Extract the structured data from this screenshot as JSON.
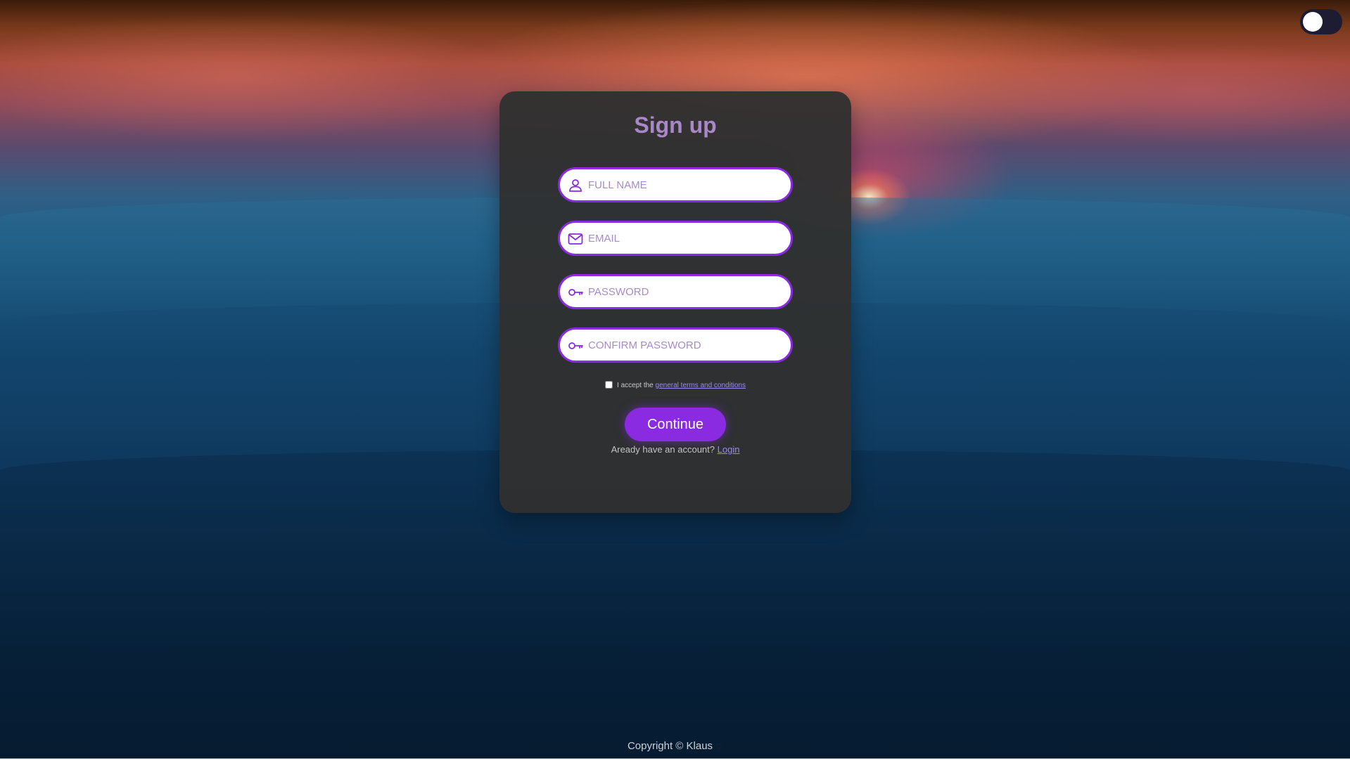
{
  "theme": {
    "accent": "#8a2be2",
    "title_color": "#a888c9",
    "card_bg": "#303030",
    "link_color": "#9a8cf0"
  },
  "theme_toggle": {
    "state": "off"
  },
  "form": {
    "title": "Sign up",
    "fields": [
      {
        "icon": "user-icon",
        "placeholder": "FULL NAME",
        "value": ""
      },
      {
        "icon": "mail-icon",
        "placeholder": "EMAIL",
        "value": ""
      },
      {
        "icon": "key-icon",
        "placeholder": "PASSWORD",
        "value": ""
      },
      {
        "icon": "key-icon",
        "placeholder": "CONFIRM PASSWORD",
        "value": ""
      }
    ],
    "terms_prefix": "I accept the",
    "terms_link": "general terms and conditions",
    "terms_checked": false,
    "submit_label": "Continue",
    "login_prompt": "Aready have an account?",
    "login_link": "Login"
  },
  "footer": {
    "copyright": "Copyright © Klaus"
  }
}
